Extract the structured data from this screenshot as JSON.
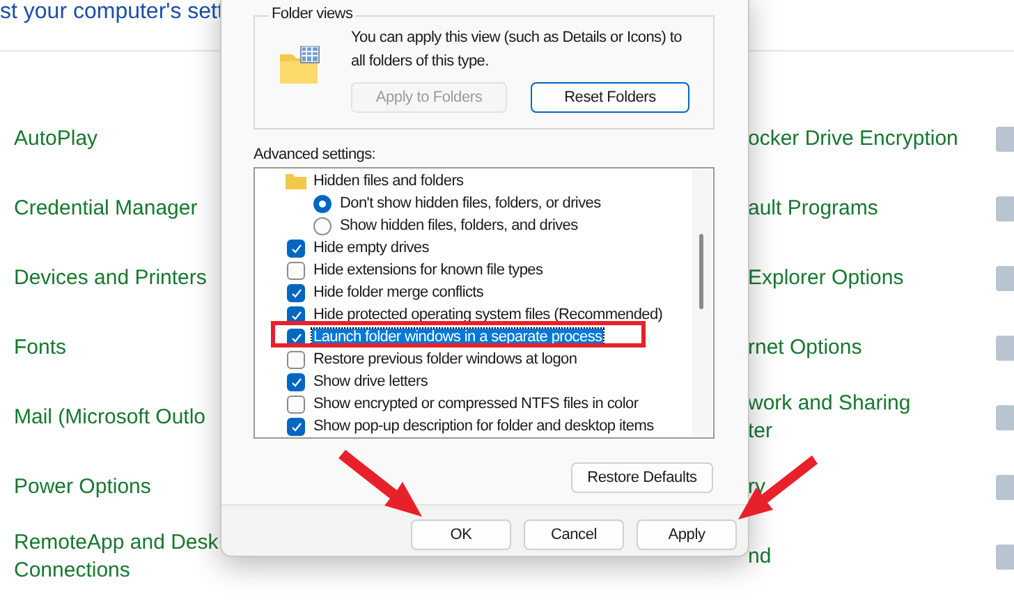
{
  "control_panel": {
    "header": "st your computer's sett",
    "left_items": [
      {
        "label": "AutoPlay"
      },
      {
        "label": "Credential Manager"
      },
      {
        "label": "Devices and Printers"
      },
      {
        "label": "Fonts"
      },
      {
        "label": "Mail (Microsoft Outlo"
      },
      {
        "label": "Power Options"
      },
      {
        "label": "RemoteApp and Desk\nConnections"
      }
    ],
    "right_items": [
      {
        "label": "ocker Drive Encryption"
      },
      {
        "label": "ault Programs"
      },
      {
        "label": "Explorer Options"
      },
      {
        "label": "rnet Options"
      },
      {
        "label": "work and Sharing\nter"
      },
      {
        "label": "ry"
      },
      {
        "label": "nd"
      }
    ]
  },
  "dialog": {
    "folder_views": {
      "legend": "Folder views",
      "description": "You can apply this view (such as Details or Icons) to all folders of this type.",
      "buttons": [
        {
          "label": "Apply to Folders",
          "disabled": true
        },
        {
          "label": "Reset Folders",
          "disabled": false
        }
      ]
    },
    "advanced_label": "Advanced settings:",
    "settings": [
      {
        "kind": "folder",
        "label": "Hidden files and folders",
        "selected": false
      },
      {
        "kind": "radio",
        "label": "Don't show hidden files, folders, or drives",
        "checked": true,
        "selected": false
      },
      {
        "kind": "radio",
        "label": "Show hidden files, folders, and drives",
        "checked": false,
        "selected": false
      },
      {
        "kind": "checkbox",
        "label": "Hide empty drives",
        "checked": true,
        "selected": false
      },
      {
        "kind": "checkbox",
        "label": "Hide extensions for known file types",
        "checked": false,
        "selected": false
      },
      {
        "kind": "checkbox",
        "label": "Hide folder merge conflicts",
        "checked": true,
        "selected": false
      },
      {
        "kind": "checkbox",
        "label": "Hide protected operating system files (Recommended)",
        "checked": true,
        "selected": false
      },
      {
        "kind": "checkbox",
        "label": "Launch folder windows in a separate process",
        "checked": true,
        "selected": true
      },
      {
        "kind": "checkbox",
        "label": "Restore previous folder windows at logon",
        "checked": false,
        "selected": false
      },
      {
        "kind": "checkbox",
        "label": "Show drive letters",
        "checked": true,
        "selected": false
      },
      {
        "kind": "checkbox",
        "label": "Show encrypted or compressed NTFS files in color",
        "checked": false,
        "selected": false
      },
      {
        "kind": "checkbox",
        "label": "Show pop-up description for folder and desktop items",
        "checked": true,
        "selected": false
      }
    ],
    "restore_button": "Restore Defaults",
    "buttons": [
      "OK",
      "Cancel",
      "Apply"
    ]
  }
}
